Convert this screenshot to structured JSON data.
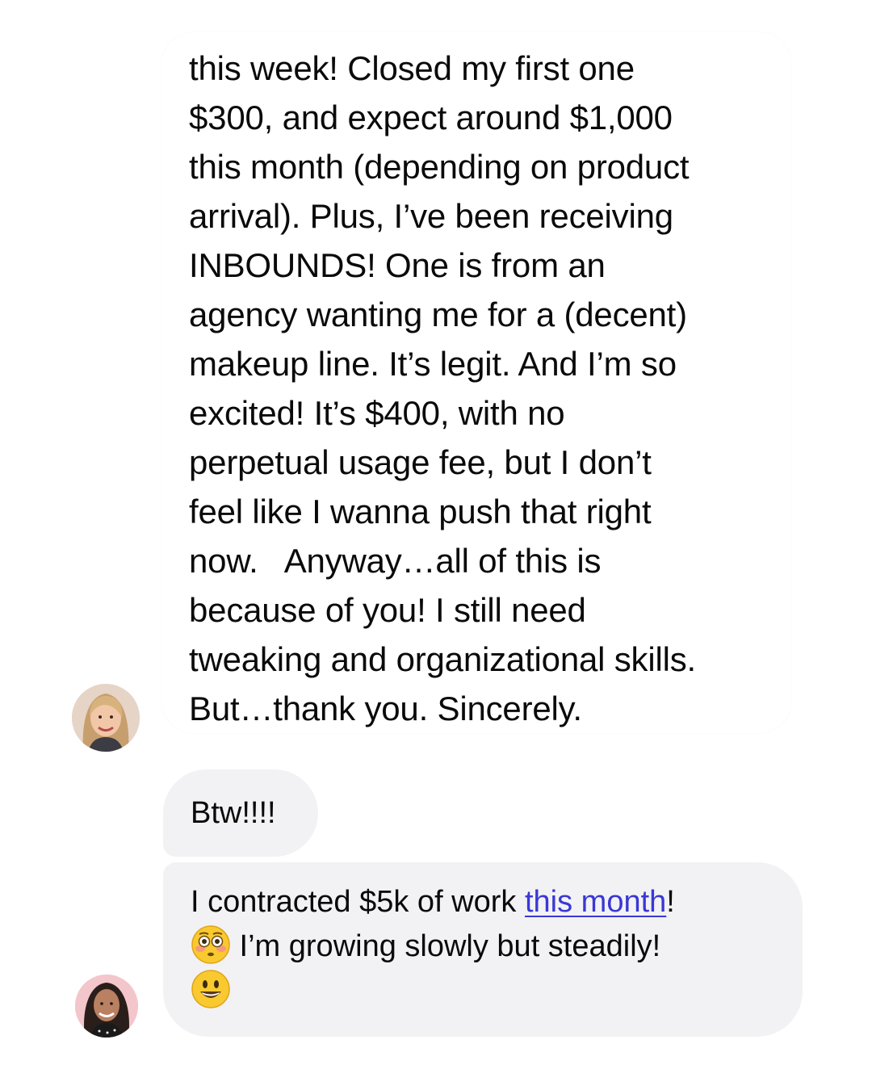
{
  "messages": [
    {
      "lines": [
        "this week! Closed my first one",
        "$300, and expect around $1,000",
        "this month (depending on product",
        "arrival). Plus, I’ve been receiving",
        "INBOUNDS! One is from an",
        "agency wanting me for a (decent)",
        "makeup line. It’s legit. And I’m so",
        "excited! It’s $400, with no",
        "perpetual usage fee, but I don’t",
        "feel like I wanna push that right",
        "now.   Anyway…all of this is",
        "because of you! I still need",
        "tweaking and organizational skills.",
        "But…thank you. Sincerely."
      ],
      "avatar": "avatar-woman-blonde"
    },
    {
      "text": "Btw!!!!"
    },
    {
      "text_before_link": "I contracted $5k of work ",
      "link_text": "this month",
      "text_after_link": "!",
      "emoji_1": "flushed-face-emoji",
      "text_line_2": " I’m growing slowly but steadily!",
      "emoji_2": "grinning-face-emoji",
      "avatar": "avatar-woman-dark-hair"
    }
  ],
  "colors": {
    "bubble_grey": "#f2f2f4",
    "link": "#3a37d6",
    "text": "#0a0a0a"
  }
}
